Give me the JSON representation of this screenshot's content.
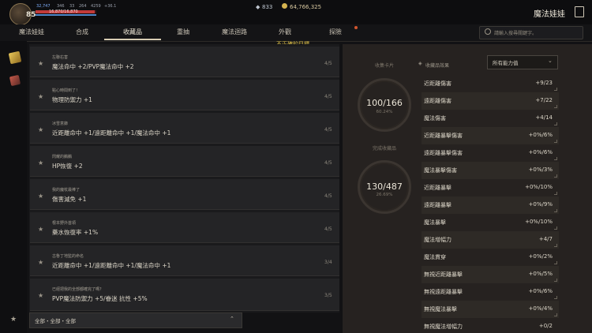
{
  "player": {
    "level": "85",
    "stats": [
      "32,747",
      "346",
      "33",
      "264",
      "4259",
      "+36.1"
    ],
    "hp_text": "16,870/16,870",
    "hp_fraction": 0.97,
    "mp_fraction": 1.0
  },
  "currency": {
    "crystal": "833",
    "gold": "64,766,325"
  },
  "header": {
    "title": "魔法娃娃"
  },
  "tabs": [
    {
      "label": "魔法娃娃"
    },
    {
      "label": "合成"
    },
    {
      "label": "收藏品"
    },
    {
      "label": "重抽"
    },
    {
      "label": "魔法迴路"
    },
    {
      "label": "外觀"
    },
    {
      "label": "探險"
    }
  ],
  "active_tab_index": 2,
  "search": {
    "placeholder": "請輸入搜尋關鍵字。"
  },
  "warning": "不正確的目標。",
  "collections": [
    {
      "name": "左聯右害",
      "effect": "魔法命中 +2/PVP魔法命中 +2",
      "count": "4/5"
    },
    {
      "name": "點心時間到了！",
      "effect": "物理防禦力 +1",
      "count": "4/5"
    },
    {
      "name": "冰雪意錄",
      "effect": "近距離命中 +1/遠距離命中 +1/魔法命中 +1",
      "count": "4/5"
    },
    {
      "name": "閃耀的鵝鵝",
      "effect": "HP恢復 +2",
      "count": "4/5"
    },
    {
      "name": "我的魔杖最棒了",
      "effect": "傷害減免 +1",
      "count": "4/5"
    },
    {
      "name": "根本野外首領",
      "effect": "藥水恢復率 +1%",
      "count": "4/5"
    },
    {
      "name": "古魯丁地監的命名",
      "effect": "近距離命中 +1/遠距離命中 +1/魔法命中 +1",
      "count": "3/4"
    },
    {
      "name": "已經把我的全部都確完了嗎？",
      "effect": "PVP魔法防禦力 +5/眷迷 抗性 +5%",
      "count": "3/5"
    }
  ],
  "filter": {
    "text": "全部・全部・全部"
  },
  "summary": {
    "cards_label": "收集卡片",
    "cards_value": "100/166",
    "cards_pct": "60.24%",
    "completed_label": "完成收藏品",
    "completed_value": "130/487",
    "completed_pct": "26.69%"
  },
  "effects_header": "收藏品效果",
  "effects_dropdown": "所有能力值",
  "effects": [
    {
      "name": "近距離傷害",
      "value": "+9/23"
    },
    {
      "name": "遠距離傷害",
      "value": "+7/22"
    },
    {
      "name": "魔法傷害",
      "value": "+4/14"
    },
    {
      "name": "近距離暴擊傷害",
      "value": "+0%/6%"
    },
    {
      "name": "遠距離暴擊傷害",
      "value": "+0%/6%"
    },
    {
      "name": "魔法暴擊傷害",
      "value": "+0%/3%"
    },
    {
      "name": "近距離暴擊",
      "value": "+0%/10%"
    },
    {
      "name": "遠距離暴擊",
      "value": "+0%/9%"
    },
    {
      "name": "魔法暴擊",
      "value": "+0%/10%"
    },
    {
      "name": "魔法增幅力",
      "value": "+4/7"
    },
    {
      "name": "魔法貫穿",
      "value": "+0%/2%"
    },
    {
      "name": "無視近距離暴擊",
      "value": "+0%/5%"
    },
    {
      "name": "無視遠距離暴擊",
      "value": "+0%/6%"
    },
    {
      "name": "無視魔法暴擊",
      "value": "+0%/4%"
    },
    {
      "name": "無視魔法增幅力",
      "value": "+0/2"
    }
  ],
  "colors": {
    "accent": "#e0c24a",
    "hp": "#c23a3a",
    "mp": "#4f86c7",
    "tab_dot": "#d2552e"
  }
}
